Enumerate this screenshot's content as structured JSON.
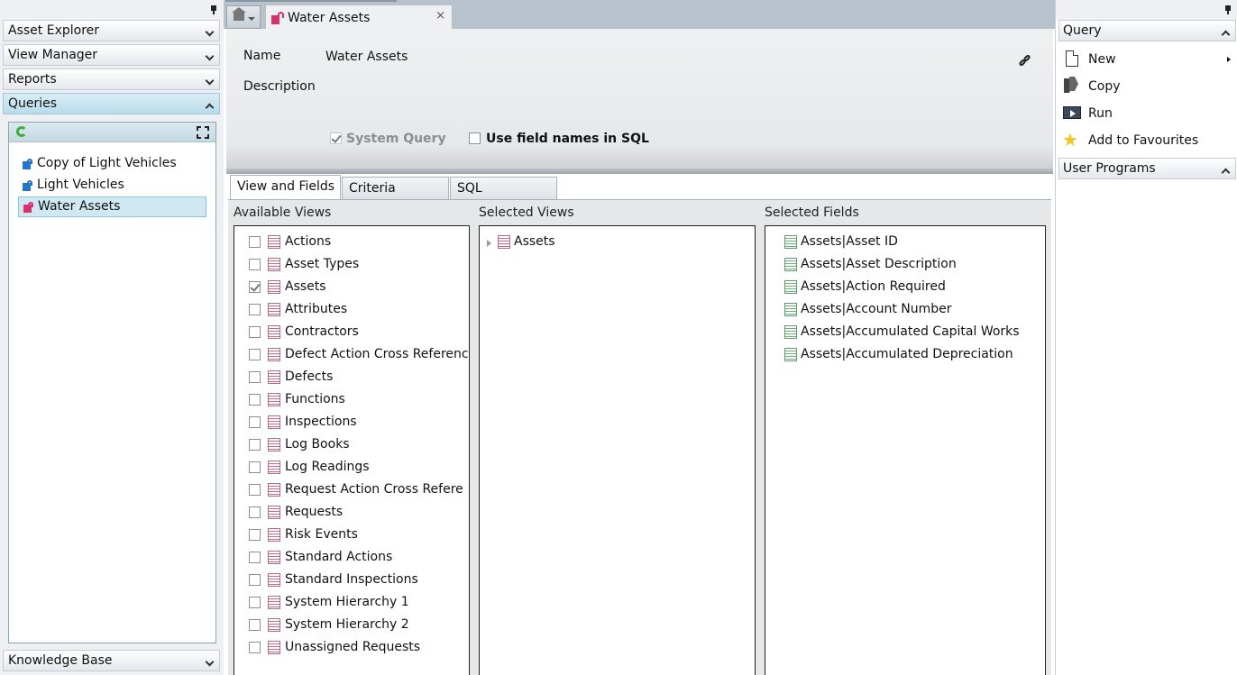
{
  "left_sidebar": {
    "sections": [
      "Asset Explorer",
      "View Manager",
      "Reports",
      "Queries"
    ],
    "bottom_section": "Knowledge Base",
    "queries": [
      "Copy of Light Vehicles",
      "Light Vehicles",
      "Water Assets"
    ],
    "selected_query": "Water Assets"
  },
  "tab": {
    "title": "Water Assets",
    "close": "×"
  },
  "header": {
    "name_label": "Name",
    "name_value": "Water Assets",
    "description_label": "Description",
    "system_query_label": "System Query",
    "system_query_checked": true,
    "use_field_names_label": "Use field names in SQL",
    "use_field_names_checked": false
  },
  "subtabs": [
    "View and Fields",
    "Criteria",
    "SQL"
  ],
  "active_subtab": "View and Fields",
  "columns": {
    "available_views_title": "Available Views",
    "selected_views_title": "Selected Views",
    "selected_fields_title": "Selected Fields"
  },
  "available_views": [
    {
      "label": "Actions",
      "checked": false
    },
    {
      "label": "Asset Types",
      "checked": false
    },
    {
      "label": "Assets",
      "checked": true
    },
    {
      "label": "Attributes",
      "checked": false
    },
    {
      "label": "Contractors",
      "checked": false
    },
    {
      "label": "Defect Action Cross Referenc",
      "checked": false
    },
    {
      "label": "Defects",
      "checked": false
    },
    {
      "label": "Functions",
      "checked": false
    },
    {
      "label": "Inspections",
      "checked": false
    },
    {
      "label": "Log Books",
      "checked": false
    },
    {
      "label": "Log Readings",
      "checked": false
    },
    {
      "label": "Request Action Cross Refere",
      "checked": false
    },
    {
      "label": "Requests",
      "checked": false
    },
    {
      "label": "Risk Events",
      "checked": false
    },
    {
      "label": "Standard Actions",
      "checked": false
    },
    {
      "label": "Standard Inspections",
      "checked": false
    },
    {
      "label": "System Hierarchy 1",
      "checked": false
    },
    {
      "label": "System Hierarchy 2",
      "checked": false
    },
    {
      "label": "Unassigned Requests",
      "checked": false
    }
  ],
  "selected_views": [
    "Assets"
  ],
  "selected_fields": [
    "Assets|Asset ID",
    "Assets|Asset Description",
    "Assets|Action Required",
    "Assets|Account Number",
    "Assets|Accumulated Capital Works",
    "Assets|Accumulated Depreciation"
  ],
  "right_sidebar": {
    "query_header": "Query",
    "menu": [
      {
        "label": "New",
        "icon": "new-document-icon",
        "has_submenu": true
      },
      {
        "label": "Copy",
        "icon": "copy-icon",
        "has_submenu": false
      },
      {
        "label": "Run",
        "icon": "run-icon",
        "has_submenu": false
      },
      {
        "label": "Add to Favourites",
        "icon": "star-icon",
        "has_submenu": false
      }
    ],
    "user_programs_header": "User Programs"
  },
  "colors": {
    "accent_pink": "#d6336c",
    "selection_blue": "#cfe8f2",
    "table_icon_green": "#6bb27a"
  }
}
